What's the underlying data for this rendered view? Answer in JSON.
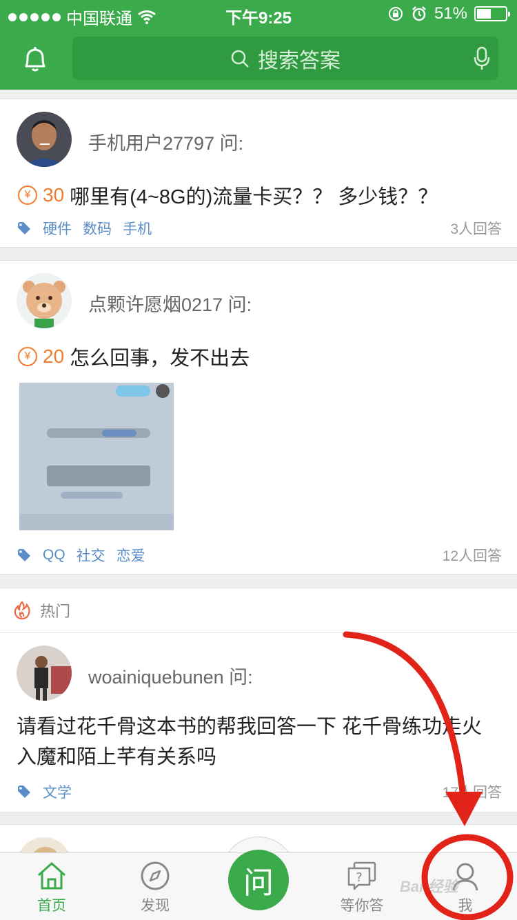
{
  "status_bar": {
    "carrier": "中国联通",
    "time": "下午9:25",
    "battery": "51%"
  },
  "search": {
    "placeholder": "搜索答案"
  },
  "questions": [
    {
      "asker": "手机用户27797 问:",
      "reward": "30",
      "text": "哪里有(4~8G的)流量卡买？？ 多少钱？？",
      "tags": [
        "硬件",
        "数码",
        "手机"
      ],
      "answers": "3人回答"
    },
    {
      "asker": "点颗许愿烟0217 问:",
      "reward": "20",
      "text": "怎么回事，发不出去",
      "tags": [
        "QQ",
        "社交",
        "恋爱"
      ],
      "answers": "12人回答"
    }
  ],
  "hot": {
    "label": "热门",
    "question": {
      "asker": "woainiquebunen 问:",
      "text_line1": "请看过花千骨这本书的帮我回答一下 花千骨练功走火",
      "text_line2": "入魔和陌上芊有关系吗",
      "tags": [
        "文学"
      ],
      "answers": "17人回答"
    }
  },
  "tabbar": {
    "home": "首页",
    "discover": "发现",
    "ask": "问",
    "waiting": "等你答",
    "me": "我"
  },
  "watermark": "Bai 经验",
  "colors": {
    "brand_green": "#3aaa4b",
    "reward_orange": "#f07c2a",
    "tag_blue": "#5b8dc8",
    "annotation_red": "#e2231a"
  }
}
